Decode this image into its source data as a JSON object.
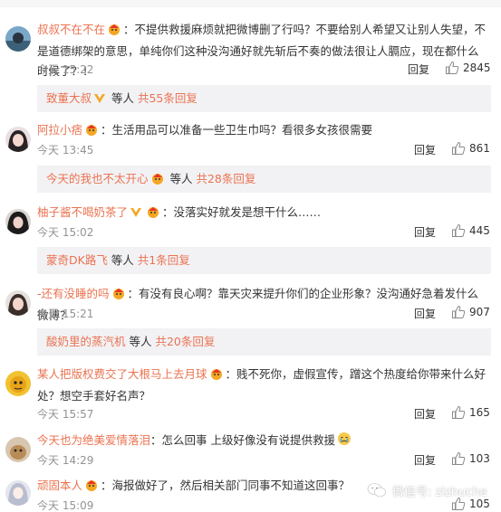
{
  "comments": [
    {
      "username": "叔叔不在不在",
      "text": "：不提供救援麻烦就把微博删了行吗？不要给别人希望又让别人失望，不是道德绑架的意思，单纯你们这种没沟通好就先斩后不奏的做法很让人膈应，现在都什么时候了？！",
      "time": "今天 15:22",
      "reply_label": "回复",
      "likes": "2845"
    },
    {
      "username": "阿拉小痞",
      "text": "：生活用品可以准备一些卫生巾吗？看很多女孩很需要",
      "time": "今天 13:45",
      "reply_label": "回复",
      "likes": "861"
    },
    {
      "username": "柚子酱不喝奶茶了",
      "text": "：没落实好就发是想干什么……",
      "time": "今天 15:02",
      "reply_label": "回复",
      "likes": "445"
    },
    {
      "username": "-还有没睡的吗",
      "text": "：有没有良心啊？靠天灾来提升你们的企业形象？没沟通好急着发什么微博？",
      "time": "今天 15:21",
      "reply_label": "回复",
      "likes": "907"
    },
    {
      "username": "某人把版权费交了大根马上去月球",
      "text": "：贱不死你，虚假宣传，蹭这个热度给你带来什么好处？想空手套好名声？",
      "time": "今天 15:57",
      "reply_label": "回复",
      "likes": "165"
    },
    {
      "username": "今天也为绝美爱情落泪",
      "text": "：怎么回事 上级好像没有说提供救援",
      "time": "今天 14:29",
      "reply_label": "回复",
      "likes": "103"
    },
    {
      "username": "顽固本人",
      "text": "：海报做好了，然后相关部门同事不知道这回事？",
      "time": "今天 15:09",
      "reply_label": "回复",
      "likes": "105"
    }
  ],
  "reply_summaries": [
    {
      "name": "致董大叔",
      "suffix": " 等人 ",
      "count": "共55条回复"
    },
    {
      "name": "今天的我也不太开心",
      "suffix": " 等人 ",
      "count": "共28条回复"
    },
    {
      "name": "蒙奇DK路飞",
      "suffix": " 等人 ",
      "count": "共1条回复"
    },
    {
      "name": "酸奶里的蒸汽机",
      "suffix": " 等人 ",
      "count": "共20条回复"
    }
  ],
  "watermark": "微信号: zizhuche",
  "colors": {
    "accent": "#eb7350",
    "reply_bg": "#f2f2f5"
  }
}
